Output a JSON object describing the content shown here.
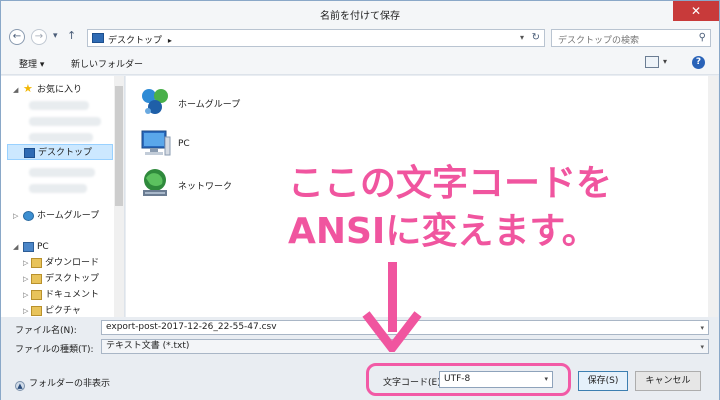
{
  "window": {
    "title": "名前を付けて保存",
    "close_glyph": "✕"
  },
  "nav": {
    "back_glyph": "←",
    "forward_glyph": "→",
    "history_glyph": "▾",
    "up_glyph": "↑",
    "breadcrumb": "デスクトップ",
    "breadcrumb_arrow": "▸",
    "dropdown_glyph": "▾",
    "refresh_glyph": "↻",
    "search_placeholder": "デスクトップの検索",
    "search_glyph": "⚲"
  },
  "toolbar": {
    "organize": "整理 ▾",
    "new_folder": "新しいフォルダー",
    "view_arrow": "▾",
    "help": "?"
  },
  "sidebar": {
    "favorites": "お気に入り",
    "desktop": "デスクトップ",
    "homegroup": "ホームグループ",
    "pc": "PC",
    "downloads": "ダウンロード",
    "pc_desktop": "デスクトップ",
    "documents": "ドキュメント",
    "pictures": "ピクチャ"
  },
  "content": {
    "items": [
      "ホームグループ",
      "PC",
      "ネットワーク"
    ]
  },
  "fields": {
    "filename_label": "ファイル名(N):",
    "filename_value": "export-post-2017-12-26_22-55-47.csv",
    "filetype_label": "ファイルの種類(T):",
    "filetype_value": "テキスト文書 (*.txt)",
    "drop_glyph": "▾"
  },
  "bottom": {
    "hide_folders": "フォルダーの非表示",
    "hide_glyph": "▲",
    "encoding_label": "文字コード(E):",
    "encoding_value": "UTF-8",
    "save": "保存(S)",
    "cancel": "キャンセル"
  },
  "annotation": {
    "line1": "ここの文字コードを",
    "line2": "ANSIに変えます。"
  },
  "colors": {
    "accent": "#f0559f",
    "close": "#c83a3a",
    "selection": "#cce8ff"
  }
}
